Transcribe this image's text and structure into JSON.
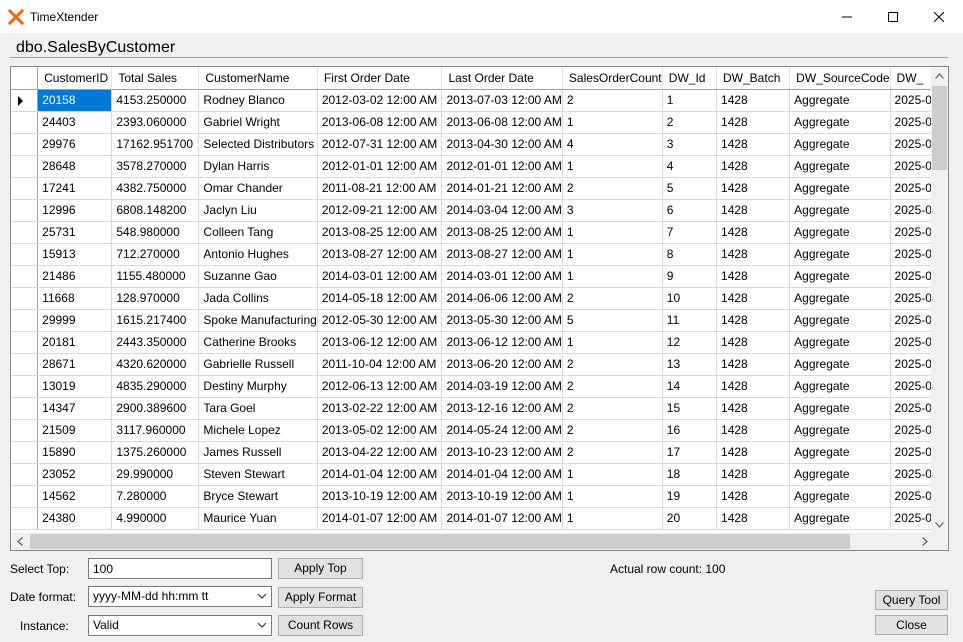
{
  "window": {
    "title": "TimeXtender",
    "accent_color": "#f7630c"
  },
  "table_title": "dbo.SalesByCustomer",
  "grid": {
    "columns": [
      "CustomerID",
      "Total Sales",
      "CustomerName",
      "First Order Date",
      "Last Order Date",
      "SalesOrderCount",
      "DW_Id",
      "DW_Batch",
      "DW_SourceCode",
      "DW_"
    ],
    "rows": [
      [
        "20158",
        "4153.250000",
        "Rodney Blanco",
        "2012-03-02 12:00 AM",
        "2013-07-03 12:00 AM",
        "2",
        "1",
        "1428",
        "Aggregate",
        "2025-0"
      ],
      [
        "24403",
        "2393.060000",
        "Gabriel Wright",
        "2013-06-08 12:00 AM",
        "2013-06-08 12:00 AM",
        "1",
        "2",
        "1428",
        "Aggregate",
        "2025-0"
      ],
      [
        "29976",
        "17162.951700",
        "Selected Distributors",
        "2012-07-31 12:00 AM",
        "2013-04-30 12:00 AM",
        "4",
        "3",
        "1428",
        "Aggregate",
        "2025-0"
      ],
      [
        "28648",
        "3578.270000",
        "Dylan Harris",
        "2012-01-01 12:00 AM",
        "2012-01-01 12:00 AM",
        "1",
        "4",
        "1428",
        "Aggregate",
        "2025-0"
      ],
      [
        "17241",
        "4382.750000",
        "Omar Chander",
        "2011-08-21 12:00 AM",
        "2014-01-21 12:00 AM",
        "2",
        "5",
        "1428",
        "Aggregate",
        "2025-0"
      ],
      [
        "12996",
        "6808.148200",
        "Jaclyn Liu",
        "2012-09-21 12:00 AM",
        "2014-03-04 12:00 AM",
        "3",
        "6",
        "1428",
        "Aggregate",
        "2025-0"
      ],
      [
        "25731",
        "548.980000",
        "Colleen Tang",
        "2013-08-25 12:00 AM",
        "2013-08-25 12:00 AM",
        "1",
        "7",
        "1428",
        "Aggregate",
        "2025-0"
      ],
      [
        "15913",
        "712.270000",
        "Antonio Hughes",
        "2013-08-27 12:00 AM",
        "2013-08-27 12:00 AM",
        "1",
        "8",
        "1428",
        "Aggregate",
        "2025-0"
      ],
      [
        "21486",
        "1155.480000",
        "Suzanne Gao",
        "2014-03-01 12:00 AM",
        "2014-03-01 12:00 AM",
        "1",
        "9",
        "1428",
        "Aggregate",
        "2025-0"
      ],
      [
        "11668",
        "128.970000",
        "Jada Collins",
        "2014-05-18 12:00 AM",
        "2014-06-06 12:00 AM",
        "2",
        "10",
        "1428",
        "Aggregate",
        "2025-0"
      ],
      [
        "29999",
        "1615.217400",
        "Spoke Manufacturing",
        "2012-05-30 12:00 AM",
        "2013-05-30 12:00 AM",
        "5",
        "11",
        "1428",
        "Aggregate",
        "2025-0"
      ],
      [
        "20181",
        "2443.350000",
        "Catherine Brooks",
        "2013-06-12 12:00 AM",
        "2013-06-12 12:00 AM",
        "1",
        "12",
        "1428",
        "Aggregate",
        "2025-0"
      ],
      [
        "28671",
        "4320.620000",
        "Gabrielle Russell",
        "2011-10-04 12:00 AM",
        "2013-06-20 12:00 AM",
        "2",
        "13",
        "1428",
        "Aggregate",
        "2025-0"
      ],
      [
        "13019",
        "4835.290000",
        "Destiny Murphy",
        "2012-06-13 12:00 AM",
        "2014-03-19 12:00 AM",
        "2",
        "14",
        "1428",
        "Aggregate",
        "2025-0"
      ],
      [
        "14347",
        "2900.389600",
        "Tara Goel",
        "2013-02-22 12:00 AM",
        "2013-12-16 12:00 AM",
        "2",
        "15",
        "1428",
        "Aggregate",
        "2025-0"
      ],
      [
        "21509",
        "3117.960000",
        "Michele Lopez",
        "2013-05-02 12:00 AM",
        "2014-05-24 12:00 AM",
        "2",
        "16",
        "1428",
        "Aggregate",
        "2025-0"
      ],
      [
        "15890",
        "1375.260000",
        "James Russell",
        "2013-04-22 12:00 AM",
        "2013-10-23 12:00 AM",
        "2",
        "17",
        "1428",
        "Aggregate",
        "2025-0"
      ],
      [
        "23052",
        "29.990000",
        "Steven Stewart",
        "2014-01-04 12:00 AM",
        "2014-01-04 12:00 AM",
        "1",
        "18",
        "1428",
        "Aggregate",
        "2025-0"
      ],
      [
        "14562",
        "7.280000",
        "Bryce Stewart",
        "2013-10-19 12:00 AM",
        "2013-10-19 12:00 AM",
        "1",
        "19",
        "1428",
        "Aggregate",
        "2025-0"
      ],
      [
        "24380",
        "4.990000",
        "Maurice Yuan",
        "2014-01-07 12:00 AM",
        "2014-01-07 12:00 AM",
        "1",
        "20",
        "1428",
        "Aggregate",
        "2025-0"
      ]
    ],
    "selected_color": "#0078d7"
  },
  "controls": {
    "select_top_label": "Select Top:",
    "select_top_value": "100",
    "apply_top": "Apply Top",
    "date_format_label": "Date format:",
    "date_format_value": "yyyy-MM-dd hh:mm tt",
    "apply_format": "Apply Format",
    "instance_label": "Instance:",
    "instance_value": "Valid",
    "count_rows": "Count Rows",
    "row_count": "Actual row count: 100",
    "query_tool": "Query Tool",
    "close": "Close"
  }
}
